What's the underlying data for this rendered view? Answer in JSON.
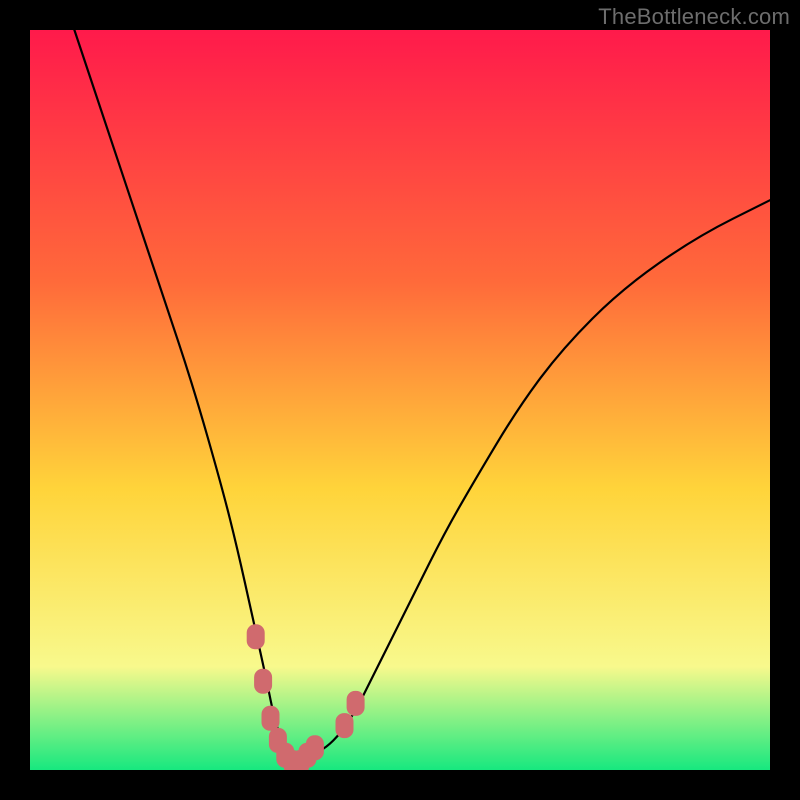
{
  "watermark": "TheBottleneck.com",
  "colors": {
    "page_bg": "#000000",
    "grad_top": "#ff1a4b",
    "grad_mid1": "#ff6a3a",
    "grad_mid2": "#ffd43a",
    "grad_mid3": "#f8f98c",
    "grad_bottom": "#17e87f",
    "curve": "#000000",
    "marker_fill": "#d06a6e",
    "marker_stroke": "#d06a6e"
  },
  "chart_data": {
    "type": "line",
    "title": "",
    "xlabel": "",
    "ylabel": "",
    "xlim": [
      0,
      100
    ],
    "ylim": [
      0,
      100
    ],
    "grid": false,
    "legend": false,
    "series": [
      {
        "name": "bottleneck-curve",
        "x": [
          6,
          10,
          14,
          18,
          22,
          26,
          28,
          30,
          32,
          33,
          34,
          35,
          36,
          37,
          38,
          40,
          42,
          44,
          46,
          48,
          52,
          56,
          60,
          66,
          72,
          80,
          90,
          100
        ],
        "y": [
          100,
          88,
          76,
          64,
          52,
          38,
          30,
          21,
          12,
          7,
          4,
          2,
          1,
          1,
          2,
          3,
          5,
          8,
          12,
          16,
          24,
          32,
          39,
          49,
          57,
          65,
          72,
          77
        ]
      }
    ],
    "markers": {
      "name": "highlighted-range",
      "x": [
        30.5,
        31.5,
        32.5,
        33.5,
        34.5,
        35.5,
        36.5,
        37.5,
        38.5,
        42.5,
        44.0
      ],
      "y": [
        18,
        12,
        7,
        4,
        2,
        1,
        1,
        2,
        3,
        6,
        9
      ]
    }
  }
}
